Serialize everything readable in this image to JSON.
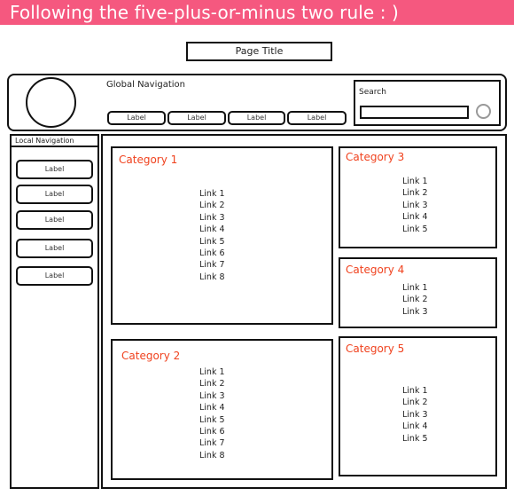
{
  "banner": {
    "text": "Following the five-plus-or-minus two rule : )",
    "color": "#f5587f"
  },
  "page_title": "Page Title",
  "header": {
    "logo_icon": "circle-logo-placeholder",
    "global_nav_title": "Global Navigation",
    "nav_items": [
      {
        "label": "Label"
      },
      {
        "label": "Label"
      },
      {
        "label": "Label"
      },
      {
        "label": "Label"
      }
    ],
    "search": {
      "label": "Search",
      "value": "",
      "button_icon": "circle-search-button"
    }
  },
  "local_nav": {
    "title": "Local Navigation",
    "items": [
      {
        "label": "Label"
      },
      {
        "label": "Label"
      },
      {
        "label": "Label"
      },
      {
        "label": "Label"
      },
      {
        "label": "Label"
      }
    ]
  },
  "accent_color": "#f0421e",
  "categories": [
    {
      "title": "Category 1",
      "links": [
        "Link 1",
        "Link 2",
        "Link 3",
        "Link 4",
        "Link 5",
        "Link 6",
        "Link 7",
        "Link 8"
      ]
    },
    {
      "title": "Category 2",
      "links": [
        "Link 1",
        "Link 2",
        "Link 3",
        "Link 4",
        "Link 5",
        "Link 6",
        "Link 7",
        "Link 8"
      ]
    },
    {
      "title": "Category 3",
      "links": [
        "Link 1",
        "Link 2",
        "Link 3",
        "Link 4",
        "Link 5"
      ]
    },
    {
      "title": "Category 4",
      "links": [
        "Link 1",
        "Link 2",
        "Link 3"
      ]
    },
    {
      "title": "Category 5",
      "links": [
        "Link 1",
        "Link 2",
        "Link 3",
        "Link 4",
        "Link 5"
      ]
    }
  ]
}
